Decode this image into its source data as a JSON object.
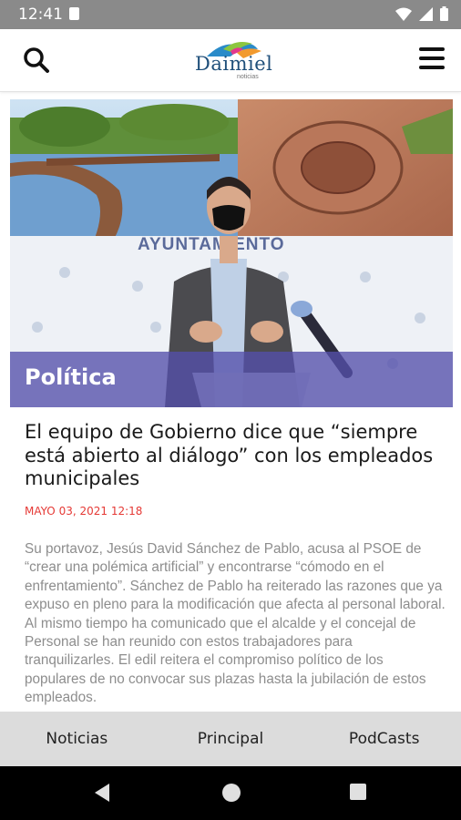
{
  "status_bar": {
    "time": "12:41"
  },
  "header": {
    "logo_text": "Daimiel",
    "logo_sub": "noticias"
  },
  "article": {
    "category": "Política",
    "headline": "El equipo de Gobierno dice que “siempre está abierto al diálogo” con los empleados municipales",
    "date": "MAYO 03, 2021 12:18",
    "body": "Su portavoz, Jesús David Sánchez de Pablo, acusa al PSOE de “crear una polémica artificial” y encontrarse “cómodo en el enfrentamiento”. Sánchez de Pablo ha reiterado las razones que ya expuso en pleno para la modificación que afecta al personal laboral. Al mismo tiempo ha comunicado que el alcalde y el concejal de Personal se han reunido con estos trabajadores para tranquilizarles. El edil reitera el compromiso político de los populares de no convocar sus plazas hasta la jubilación de estos empleados.",
    "backdrop_text": "AYUNTAMIENTO"
  },
  "bottom_nav": {
    "tabs": [
      {
        "label": "Noticias"
      },
      {
        "label": "Principal"
      },
      {
        "label": "PodCasts"
      }
    ]
  },
  "colors": {
    "category_band": "#5550aa",
    "date": "#e53935",
    "status_bar": "#8a8a8a",
    "bottom_nav": "#dcdcdc"
  },
  "icons": [
    "sd-card-icon",
    "wifi-icon",
    "signal-icon",
    "battery-icon",
    "search-icon",
    "hamburger-menu-icon",
    "back-icon",
    "home-icon",
    "recents-icon"
  ]
}
